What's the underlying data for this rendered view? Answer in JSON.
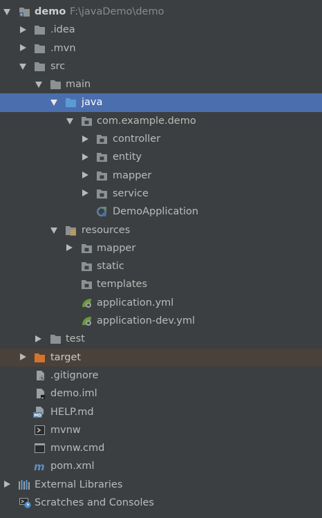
{
  "colors": {
    "background": "#3c3f41",
    "selection": "#4b6eaf",
    "excluded_row": "#4a413a",
    "folder_grey": "#8c9194",
    "folder_blue": "#5b9bd5",
    "folder_orange": "#d4732a",
    "spring_green": "#6a9a3a"
  },
  "project": {
    "name": "demo",
    "path": "F:\\javaDemo\\demo"
  },
  "tree": {
    "idea": ".idea",
    "mvn": ".mvn",
    "src": "src",
    "main": "main",
    "java": "java",
    "package": "com.example.demo",
    "controller": "controller",
    "entity": "entity",
    "mapper": "mapper",
    "service": "service",
    "demo_application": "DemoApplication",
    "resources": "resources",
    "res_mapper": "mapper",
    "static": "static",
    "templates": "templates",
    "application_yml": "application.yml",
    "application_dev_yml": "application-dev.yml",
    "test": "test",
    "target": "target",
    "gitignore": ".gitignore",
    "demo_iml": "demo.iml",
    "help_md": "HELP.md",
    "mvnw": "mvnw",
    "mvnw_cmd": "mvnw.cmd",
    "pom_xml": "pom.xml",
    "external_libraries": "External Libraries",
    "scratches": "Scratches and Consoles"
  }
}
